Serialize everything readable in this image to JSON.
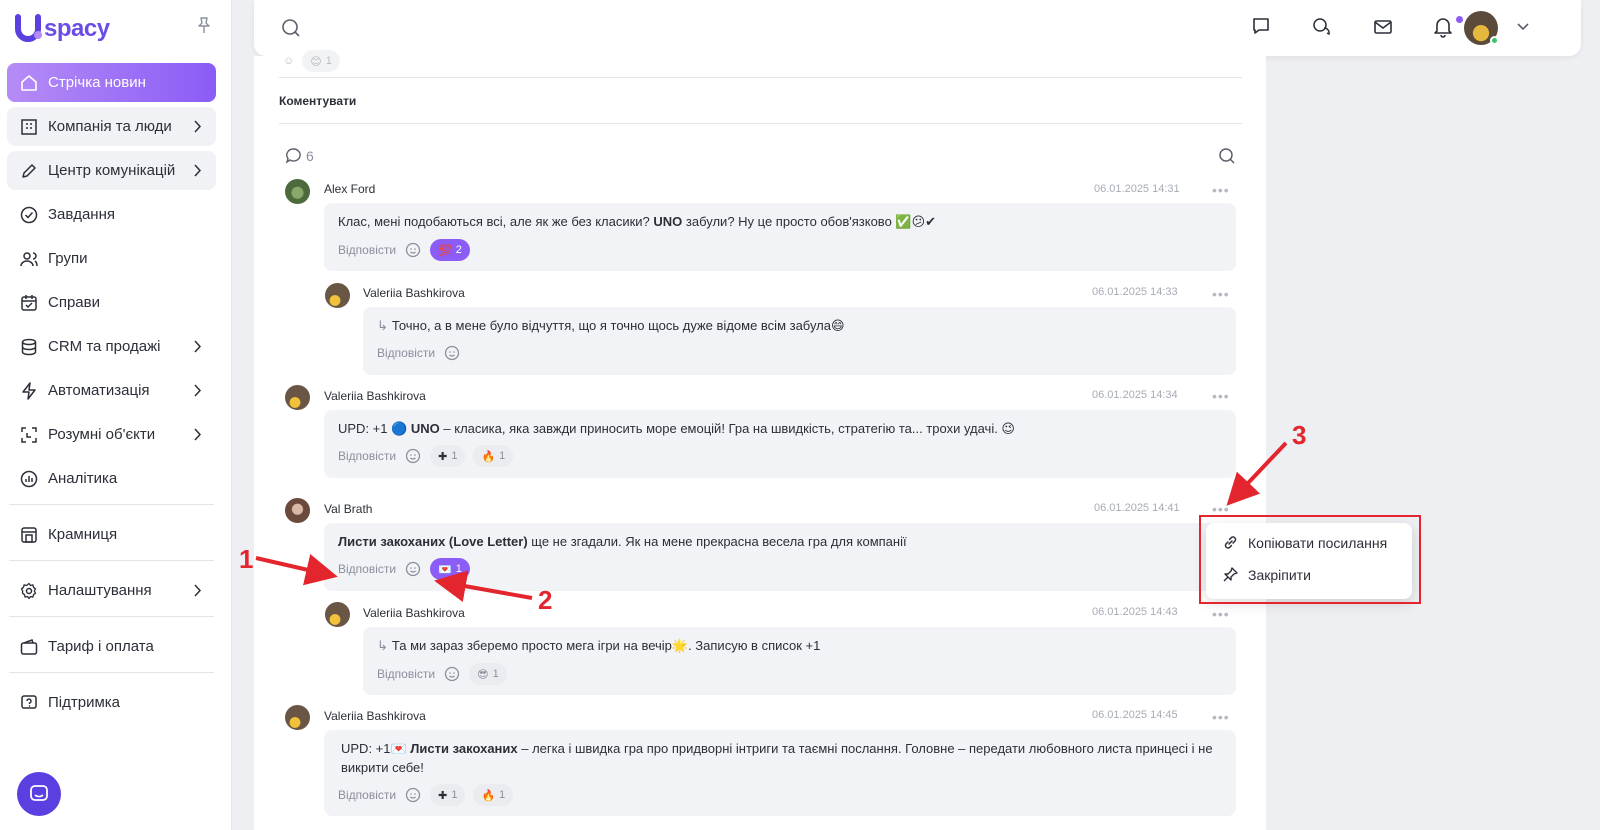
{
  "app": {
    "name": "spacy"
  },
  "sidebar": {
    "items": [
      {
        "label": "Стрічка новин",
        "icon": "home-icon"
      },
      {
        "label": "Компанія та люди",
        "icon": "building-icon"
      },
      {
        "label": "Центр комунікацій",
        "icon": "edit-icon"
      },
      {
        "label": "Завдання",
        "icon": "check-circle-icon"
      },
      {
        "label": "Групи",
        "icon": "users-icon"
      },
      {
        "label": "Справи",
        "icon": "calendar-icon"
      },
      {
        "label": "CRM та продажі",
        "icon": "database-icon"
      },
      {
        "label": "Автоматизація",
        "icon": "lightning-icon"
      },
      {
        "label": "Розумні об'єкти",
        "icon": "scan-icon"
      },
      {
        "label": "Аналітика",
        "icon": "chart-icon"
      },
      {
        "label": "Крамниця",
        "icon": "store-icon"
      },
      {
        "label": "Налаштування",
        "icon": "gear-icon"
      },
      {
        "label": "Тариф і оплата",
        "icon": "wallet-icon"
      },
      {
        "label": "Підтримка",
        "icon": "help-icon"
      }
    ]
  },
  "feed": {
    "comment_label": "Коментувати",
    "comment_count": "6",
    "partial_reaction": "1",
    "comments": [
      {
        "author": "Alex Ford",
        "date": "06.01.2025 14:31",
        "text_pre": "Клас, мені подобаються всі, але як же без класики? ",
        "text_bold": "UNO",
        "text_post": " забули? Ну це просто обов'язково ✅😕✔",
        "reply": "Відповісти",
        "reactions": [
          {
            "emoji": "💯",
            "count": "2",
            "active": true
          }
        ]
      },
      {
        "author": "Valeriia Bashkirova",
        "date": "06.01.2025 14:33",
        "text": "Точно, а в мене було відчуття, що я точно щось дуже відоме всім забула😄",
        "reply": "Відповісти"
      },
      {
        "author": "Valeriia Bashkirova",
        "date": "06.01.2025 14:34",
        "text_pre": "UPD: +1 🔵 ",
        "text_bold": "UNO",
        "text_post": "  – класика, яка завжди приносить море емоцій! Гра на швидкість, стратегію та... трохи удачі. 😉",
        "reply": "Відповісти",
        "reactions": [
          {
            "emoji": "✚",
            "count": "1"
          },
          {
            "emoji": "🔥",
            "count": "1"
          }
        ]
      },
      {
        "author": "Val Brath",
        "date": "06.01.2025 14:41",
        "text_bold": "Листи закоханих (Love Letter)",
        "text_post": " ще не згадали. Як на мене прекрасна весела гра для компанії",
        "reply": "Відповісти",
        "reactions": [
          {
            "emoji": "💌",
            "count": "1",
            "active": true
          }
        ]
      },
      {
        "author": "Valeriia Bashkirova",
        "date": "06.01.2025 14:43",
        "text": "Та ми зараз зберемо просто мега ігри на вечір🌟. Записую в список +1",
        "reply": "Відповісти",
        "reactions": [
          {
            "emoji": "😎",
            "count": "1"
          }
        ]
      },
      {
        "author": "Valeriia Bashkirova",
        "date": "06.01.2025 14:45",
        "text_pre": "UPD: +1💌 ",
        "text_bold": "Листи закоханих",
        "text_post": " – легка і швидка гра про придворні інтриги та таємні послання. Головне – передати любовного листа принцесі і не викрити себе!",
        "reply": "Відповісти",
        "reactions": [
          {
            "emoji": "✚",
            "count": "1"
          },
          {
            "emoji": "🔥",
            "count": "1"
          }
        ]
      }
    ]
  },
  "context_menu": {
    "items": [
      {
        "label": "Копіювати посилання",
        "icon": "link-icon"
      },
      {
        "label": "Закріпити",
        "icon": "pin-icon"
      }
    ]
  },
  "annotations": [
    "1",
    "2",
    "3"
  ],
  "colors": {
    "accent": "#8b5cf6",
    "annotation": "#e3262e"
  }
}
